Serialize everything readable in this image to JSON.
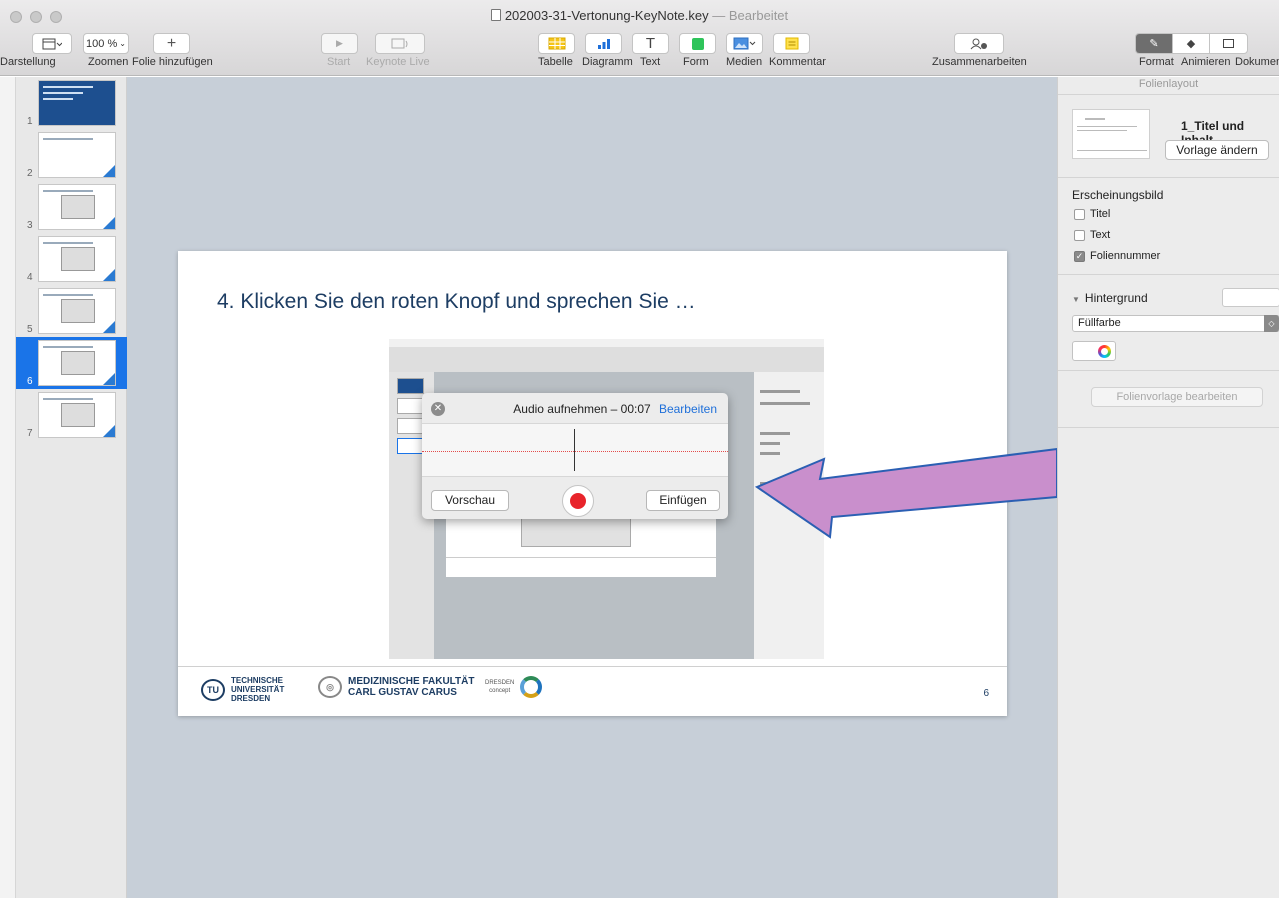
{
  "window": {
    "title": "202003-31-Vertonung-KeyNote.key",
    "title_sep": "—",
    "status": "Bearbeitet"
  },
  "toolbar": {
    "view_label": "Darstellung",
    "zoom_value": "100 %",
    "zoom_label": "Zoomen",
    "add_slide_label": "Folie hinzufügen",
    "play_label": "Start",
    "live_label": "Keynote Live",
    "table_label": "Tabelle",
    "chart_label": "Diagramm",
    "text_label": "Text",
    "shape_label": "Form",
    "media_label": "Medien",
    "comment_label": "Kommentar",
    "collab_label": "Zusammenarbeiten",
    "format_label": "Format",
    "animate_label": "Animieren",
    "document_label": "Dokument",
    "colors": {
      "table": "#f5c518",
      "chart": "#1e6fd9",
      "shape": "#2ec45a",
      "media": "#4a8fe0",
      "comment": "#ffe14d"
    }
  },
  "navigator": {
    "slides": [
      {
        "num": "1"
      },
      {
        "num": "2"
      },
      {
        "num": "3"
      },
      {
        "num": "4"
      },
      {
        "num": "5"
      },
      {
        "num": "6"
      },
      {
        "num": "7"
      }
    ],
    "selected": "6"
  },
  "slide": {
    "title": "4. Klicken Sie den roten Knopf und sprechen Sie …",
    "number": "6",
    "footer": {
      "tu_line1": "TECHNISCHE",
      "tu_line2": "UNIVERSITÄT",
      "tu_line3": "DRESDEN",
      "med_line1": "MEDIZINISCHE FAKULTÄT",
      "med_line2": "CARL GUSTAV CARUS",
      "dresden_line1": "DRESDEN",
      "dresden_line2": "concept"
    }
  },
  "audio_dialog": {
    "title": "Audio aufnehmen – 00:07",
    "edit_label": "Bearbeiten",
    "preview_label": "Vorschau",
    "insert_label": "Einfügen",
    "record_color": "#e8242b"
  },
  "annotation": {
    "arrow_color": "#c98fcc",
    "arrow_stroke": "#2b5fb3"
  },
  "inspector": {
    "header": "Folienlayout",
    "layout_name": "1_Titel und Inhalt",
    "change_master_label": "Vorlage ändern",
    "appearance_title": "Erscheinungsbild",
    "options": [
      {
        "label": "Titel",
        "checked": false
      },
      {
        "label": "Text",
        "checked": false
      },
      {
        "label": "Foliennummer",
        "checked": true
      }
    ],
    "background_title": "Hintergrund",
    "fill_select": "Füllfarbe",
    "edit_master_label": "Folienvorlage bearbeiten"
  }
}
